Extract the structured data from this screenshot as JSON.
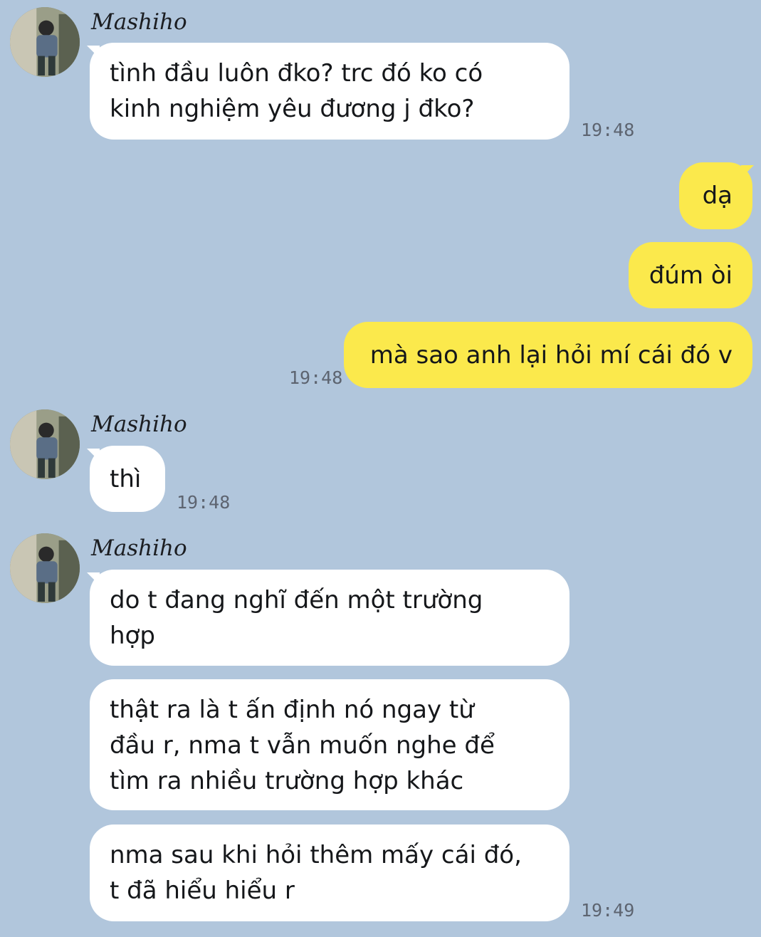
{
  "colors": {
    "background": "#b1c6dc",
    "incoming_bubble": "#ffffff",
    "outgoing_bubble": "#fbe94c",
    "timestamp": "#5d6470"
  },
  "groups": [
    {
      "sender": "Mashiho",
      "avatar_icon": "profile-photo",
      "messages": [
        "tình đầu luôn đko? trc đó ko có\nkinh nghiệm yêu đương j đko?"
      ],
      "time": "19:48"
    },
    {
      "direction": "outgoing",
      "messages": [
        "dạ",
        "đúm òi",
        "mà sao anh lại hỏi mí cái đó v"
      ],
      "time": "19:48"
    },
    {
      "sender": "Mashiho",
      "avatar_icon": "profile-photo",
      "messages": [
        "thì"
      ],
      "time": "19:48"
    },
    {
      "sender": "Mashiho",
      "avatar_icon": "profile-photo",
      "messages": [
        "do t đang nghĩ đến một trường\nhợp",
        "thật ra là t ấn định nó ngay từ\nđầu r, nma t vẫn muốn nghe để\ntìm ra nhiều trường hợp khác",
        "nma sau khi hỏi thêm mấy cái đó,\nt đã hiểu hiểu r"
      ],
      "time": "19:49"
    }
  ]
}
